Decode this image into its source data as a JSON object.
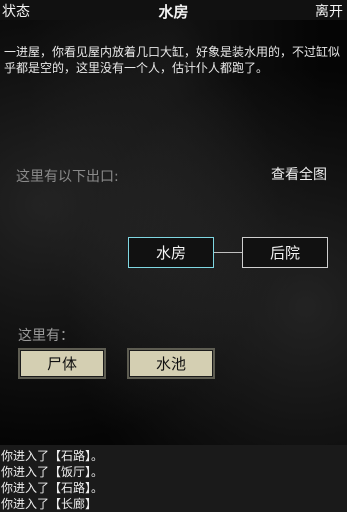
{
  "topbar": {
    "left": "状态",
    "title": "水房",
    "right": "离开"
  },
  "description": "一进屋，你看见屋内放着几口大缸，好象是装水用的，不过缸似乎都是空的，这里没有一个人，估计仆人都跑了。",
  "exits": {
    "label": "这里有以下出口:",
    "view_map": "查看全图",
    "current_room": "水房",
    "rooms": [
      "后院"
    ]
  },
  "here": {
    "label": "这里有：",
    "objects": [
      "尸体",
      "水池"
    ]
  },
  "log": [
    "你进入了【石路】。",
    "你进入了【饭厅】。",
    "你进入了【石路】。",
    "你进入了【长廊】"
  ],
  "colors": {
    "current_room_border": "#7fd7e2",
    "object_button_bg": "#d4cfb2"
  }
}
